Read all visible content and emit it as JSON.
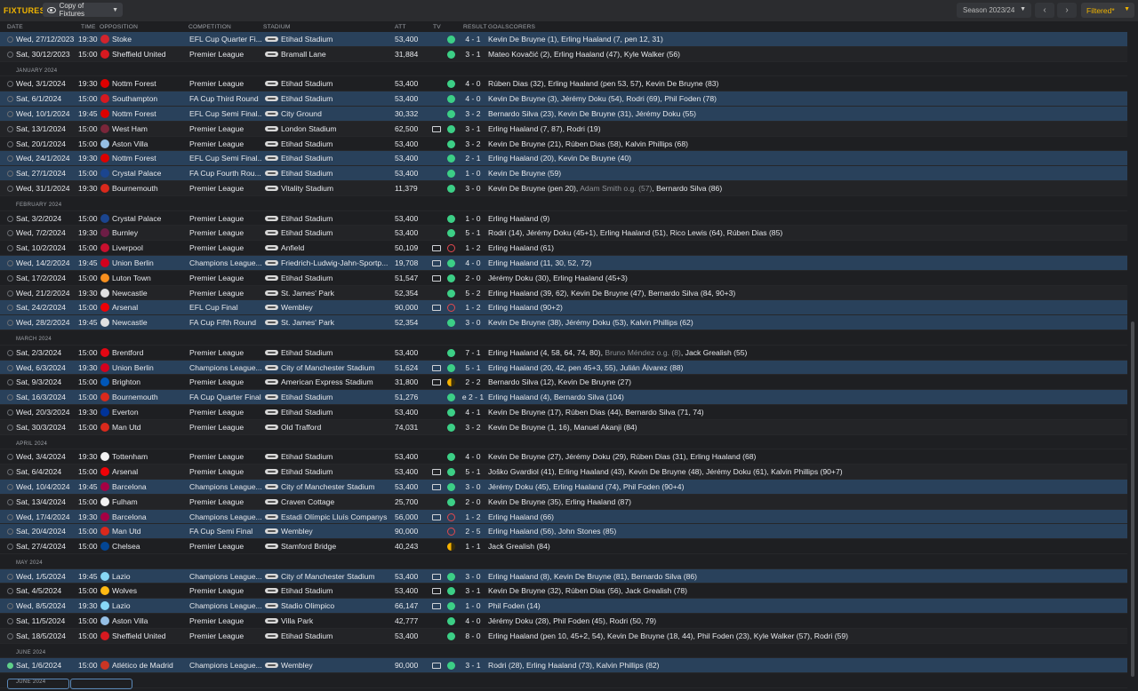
{
  "header": {
    "title": "FIXTURES",
    "view_label": "Copy of Fixtures",
    "season": "Season 2023/24",
    "filter_label": "Filtered*"
  },
  "columns": {
    "date": "DATE",
    "time": "TIME",
    "opposition": "OPPOSITION",
    "competition": "COMPETITION",
    "stadium": "STADIUM",
    "att": "ATT",
    "tv": "TV",
    "result": "RESULT",
    "goalscorers": "GOALSCORERS"
  },
  "colors": {
    "win": "#3ccf86",
    "loss": "#e0484f",
    "draw": "#f5b100",
    "accent": "#f0b400",
    "highlight_row": "#29415b"
  },
  "rows": [
    {
      "date": "Wed, 27/12/2023",
      "time": "19:30",
      "opp": "Stoke",
      "crest": "#d2242d",
      "comp": "EFL Cup Quarter Fi...",
      "stadium": "Etihad Stadium",
      "att": "53,400",
      "tv": false,
      "res": "w",
      "score": "4 - 1",
      "scorers": "Kevin De Bruyne (1), Erling Haaland (7, pen 12, 31)",
      "hl": true
    },
    {
      "date": "Sat, 30/12/2023",
      "time": "15:00",
      "opp": "Sheffield United",
      "crest": "#d71920",
      "comp": "Premier League",
      "stadium": "Bramall Lane",
      "att": "31,884",
      "tv": false,
      "res": "w",
      "score": "3 - 1",
      "scorers": "Mateo Kovačić (2), Erling Haaland (47), Kyle Walker (56)"
    },
    {
      "section": "JANUARY 2024"
    },
    {
      "date": "Wed, 3/1/2024",
      "time": "19:30",
      "opp": "Nottm Forest",
      "crest": "#dd0000",
      "comp": "Premier League",
      "stadium": "Etihad Stadium",
      "att": "53,400",
      "tv": false,
      "res": "w",
      "score": "4 - 0",
      "scorers": "Rúben Dias (32), Erling Haaland (pen 53, 57), Kevin De Bruyne (83)"
    },
    {
      "date": "Sat, 6/1/2024",
      "time": "15:00",
      "opp": "Southampton",
      "crest": "#d71920",
      "comp": "FA Cup Third Round",
      "stadium": "Etihad Stadium",
      "att": "53,400",
      "tv": false,
      "res": "w",
      "score": "4 - 0",
      "scorers": "Kevin De Bruyne (3), Jérémy Doku (54), Rodri (69), Phil Foden (78)",
      "hl": true
    },
    {
      "date": "Wed, 10/1/2024",
      "time": "19:45",
      "opp": "Nottm Forest",
      "crest": "#dd0000",
      "comp": "EFL Cup Semi Final...",
      "stadium": "City Ground",
      "att": "30,332",
      "tv": false,
      "res": "w",
      "score": "3 - 2",
      "scorers": "Bernardo Silva (23), Kevin De Bruyne (31), Jérémy Doku (55)",
      "hl": true
    },
    {
      "date": "Sat, 13/1/2024",
      "time": "15:00",
      "opp": "West Ham",
      "crest": "#7a263a",
      "comp": "Premier League",
      "stadium": "London Stadium",
      "att": "62,500",
      "tv": true,
      "res": "w",
      "score": "3 - 1",
      "scorers": "Erling Haaland (7, 87), Rodri (19)"
    },
    {
      "date": "Sat, 20/1/2024",
      "time": "15:00",
      "opp": "Aston Villa",
      "crest": "#95bfe5",
      "comp": "Premier League",
      "stadium": "Etihad Stadium",
      "att": "53,400",
      "tv": false,
      "res": "w",
      "score": "3 - 2",
      "scorers": "Kevin De Bruyne (21), Rúben Dias (58), Kalvin Phillips (68)"
    },
    {
      "date": "Wed, 24/1/2024",
      "time": "19:30",
      "opp": "Nottm Forest",
      "crest": "#dd0000",
      "comp": "EFL Cup Semi Final...",
      "stadium": "Etihad Stadium",
      "att": "53,400",
      "tv": false,
      "res": "w",
      "score": "2 - 1",
      "scorers": "Erling Haaland (20), Kevin De Bruyne (40)",
      "hl": true
    },
    {
      "date": "Sat, 27/1/2024",
      "time": "15:00",
      "opp": "Crystal Palace",
      "crest": "#1b458f",
      "comp": "FA Cup Fourth Rou...",
      "stadium": "Etihad Stadium",
      "att": "53,400",
      "tv": false,
      "res": "w",
      "score": "1 - 0",
      "scorers": "Kevin De Bruyne (59)",
      "hl": true
    },
    {
      "date": "Wed, 31/1/2024",
      "time": "19:30",
      "opp": "Bournemouth",
      "crest": "#da291c",
      "comp": "Premier League",
      "stadium": "Vitality Stadium",
      "att": "11,379",
      "tv": false,
      "res": "w",
      "score": "3 - 0",
      "scorers": "Kevin De Bruyne (pen 20), {og}Adam Smith o.g. (57){/og}, Bernardo Silva (86)"
    },
    {
      "section": "FEBRUARY 2024"
    },
    {
      "date": "Sat, 3/2/2024",
      "time": "15:00",
      "opp": "Crystal Palace",
      "crest": "#1b458f",
      "comp": "Premier League",
      "stadium": "Etihad Stadium",
      "att": "53,400",
      "tv": false,
      "res": "w",
      "score": "1 - 0",
      "scorers": "Erling Haaland (9)"
    },
    {
      "date": "Wed, 7/2/2024",
      "time": "19:30",
      "opp": "Burnley",
      "crest": "#6c1d45",
      "comp": "Premier League",
      "stadium": "Etihad Stadium",
      "att": "53,400",
      "tv": false,
      "res": "w",
      "score": "5 - 1",
      "scorers": "Rodri (14), Jérémy Doku (45+1), Erling Haaland (51), Rico Lewis (64), Rúben Dias (85)"
    },
    {
      "date": "Sat, 10/2/2024",
      "time": "15:00",
      "opp": "Liverpool",
      "crest": "#c8102e",
      "comp": "Premier League",
      "stadium": "Anfield",
      "att": "50,109",
      "tv": true,
      "res": "l",
      "score": "1 - 2",
      "scorers": "Erling Haaland (61)"
    },
    {
      "date": "Wed, 14/2/2024",
      "time": "19:45",
      "opp": "Union Berlin",
      "crest": "#d4011d",
      "comp": "Champions League...",
      "stadium": "Friedrich-Ludwig-Jahn-Sportp...",
      "att": "19,708",
      "tv": true,
      "res": "w",
      "score": "4 - 0",
      "scorers": "Erling Haaland (11, 30, 52, 72)",
      "hl": true
    },
    {
      "date": "Sat, 17/2/2024",
      "time": "15:00",
      "opp": "Luton Town",
      "crest": "#f78f1e",
      "comp": "Premier League",
      "stadium": "Etihad Stadium",
      "att": "51,547",
      "tv": true,
      "res": "w",
      "score": "2 - 0",
      "scorers": "Jérémy Doku (30), Erling Haaland (45+3)"
    },
    {
      "date": "Wed, 21/2/2024",
      "time": "19:30",
      "opp": "Newcastle",
      "crest": "#e0e0e0",
      "comp": "Premier League",
      "stadium": "St. James' Park",
      "att": "52,354",
      "tv": false,
      "res": "w",
      "score": "5 - 2",
      "scorers": "Erling Haaland (39, 62), Kevin De Bruyne (47), Bernardo Silva (84, 90+3)"
    },
    {
      "date": "Sat, 24/2/2024",
      "time": "15:00",
      "opp": "Arsenal",
      "crest": "#ef0107",
      "comp": "EFL Cup Final",
      "stadium": "Wembley",
      "att": "90,000",
      "tv": true,
      "res": "l",
      "score": "1 - 2",
      "scorers": "Erling Haaland (90+2)",
      "hl": true
    },
    {
      "date": "Wed, 28/2/2024",
      "time": "19:45",
      "opp": "Newcastle",
      "crest": "#e0e0e0",
      "comp": "FA Cup Fifth Round",
      "stadium": "St. James' Park",
      "att": "52,354",
      "tv": false,
      "res": "w",
      "score": "3 - 0",
      "scorers": "Kevin De Bruyne (38), Jérémy Doku (53), Kalvin Phillips (62)",
      "hl": true
    },
    {
      "section": "MARCH 2024"
    },
    {
      "date": "Sat, 2/3/2024",
      "time": "15:00",
      "opp": "Brentford",
      "crest": "#e30613",
      "comp": "Premier League",
      "stadium": "Etihad Stadium",
      "att": "53,400",
      "tv": false,
      "res": "w",
      "score": "7 - 1",
      "scorers": "Erling Haaland (4, 58, 64, 74, 80), {og}Bruno Méndez o.g. (8){/og}, Jack Grealish (55)"
    },
    {
      "date": "Wed, 6/3/2024",
      "time": "19:30",
      "opp": "Union Berlin",
      "crest": "#d4011d",
      "comp": "Champions League...",
      "stadium": "City of Manchester Stadium",
      "att": "51,624",
      "tv": true,
      "res": "w",
      "score": "5 - 1",
      "scorers": "Erling Haaland (20, 42, pen 45+3, 55), Julián Álvarez (88)",
      "hl": true
    },
    {
      "date": "Sat, 9/3/2024",
      "time": "15:00",
      "opp": "Brighton",
      "crest": "#0057b8",
      "comp": "Premier League",
      "stadium": "American Express Stadium",
      "att": "31,800",
      "tv": true,
      "res": "d",
      "score": "2 - 2",
      "scorers": "Bernardo Silva (12), Kevin De Bruyne (27)"
    },
    {
      "date": "Sat, 16/3/2024",
      "time": "15:00",
      "opp": "Bournemouth",
      "crest": "#da291c",
      "comp": "FA Cup Quarter Final",
      "stadium": "Etihad Stadium",
      "att": "51,276",
      "tv": false,
      "res": "w",
      "score": "e 2 - 1",
      "scorers": "Erling Haaland (4), Bernardo Silva (104)",
      "hl": true
    },
    {
      "date": "Wed, 20/3/2024",
      "time": "19:30",
      "opp": "Everton",
      "crest": "#003399",
      "comp": "Premier League",
      "stadium": "Etihad Stadium",
      "att": "53,400",
      "tv": false,
      "res": "w",
      "score": "4 - 1",
      "scorers": "Kevin De Bruyne (17), Rúben Dias (44), Bernardo Silva (71, 74)"
    },
    {
      "date": "Sat, 30/3/2024",
      "time": "15:00",
      "opp": "Man Utd",
      "crest": "#da291c",
      "comp": "Premier League",
      "stadium": "Old Trafford",
      "att": "74,031",
      "tv": false,
      "res": "w",
      "score": "3 - 2",
      "scorers": "Kevin De Bruyne (1, 16), Manuel Akanji (84)"
    },
    {
      "section": "APRIL 2024"
    },
    {
      "date": "Wed, 3/4/2024",
      "time": "19:30",
      "opp": "Tottenham",
      "crest": "#f2f2f2",
      "comp": "Premier League",
      "stadium": "Etihad Stadium",
      "att": "53,400",
      "tv": false,
      "res": "w",
      "score": "4 - 0",
      "scorers": "Kevin De Bruyne (27), Jérémy Doku (29), Rúben Dias (31), Erling Haaland (68)"
    },
    {
      "date": "Sat, 6/4/2024",
      "time": "15:00",
      "opp": "Arsenal",
      "crest": "#ef0107",
      "comp": "Premier League",
      "stadium": "Etihad Stadium",
      "att": "53,400",
      "tv": true,
      "res": "w",
      "score": "5 - 1",
      "scorers": "Joško Gvardiol (41), Erling Haaland (43), Kevin De Bruyne (48), Jérémy Doku (61), Kalvin Phillips (90+7)"
    },
    {
      "date": "Wed, 10/4/2024",
      "time": "19:45",
      "opp": "Barcelona",
      "crest": "#a50044",
      "comp": "Champions League...",
      "stadium": "City of Manchester Stadium",
      "att": "53,400",
      "tv": true,
      "res": "w",
      "score": "3 - 0",
      "scorers": "Jérémy Doku (45), Erling Haaland (74), Phil Foden (90+4)",
      "hl": true
    },
    {
      "date": "Sat, 13/4/2024",
      "time": "15:00",
      "opp": "Fulham",
      "crest": "#f2f2f2",
      "comp": "Premier League",
      "stadium": "Craven Cottage",
      "att": "25,700",
      "tv": false,
      "res": "w",
      "score": "2 - 0",
      "scorers": "Kevin De Bruyne (35), Erling Haaland (87)"
    },
    {
      "date": "Wed, 17/4/2024",
      "time": "19:30",
      "opp": "Barcelona",
      "crest": "#a50044",
      "comp": "Champions League...",
      "stadium": "Estadi Olímpic Lluís Companys",
      "att": "56,000",
      "tv": true,
      "res": "l",
      "score": "1 - 2",
      "scorers": "Erling Haaland (66)",
      "hl": true
    },
    {
      "date": "Sat, 20/4/2024",
      "time": "15:00",
      "opp": "Man Utd",
      "crest": "#da291c",
      "comp": "FA Cup Semi Final",
      "stadium": "Wembley",
      "att": "90,000",
      "tv": false,
      "res": "l",
      "score": "2 - 5",
      "scorers": "Erling Haaland (56), John Stones (85)",
      "hl": true
    },
    {
      "date": "Sat, 27/4/2024",
      "time": "15:00",
      "opp": "Chelsea",
      "crest": "#034694",
      "comp": "Premier League",
      "stadium": "Stamford Bridge",
      "att": "40,243",
      "tv": false,
      "res": "d",
      "score": "1 - 1",
      "scorers": "Jack Grealish (84)"
    },
    {
      "section": "MAY 2024"
    },
    {
      "date": "Wed, 1/5/2024",
      "time": "19:45",
      "opp": "Lazio",
      "crest": "#87d8f7",
      "comp": "Champions League...",
      "stadium": "City of Manchester Stadium",
      "att": "53,400",
      "tv": true,
      "res": "w",
      "score": "3 - 0",
      "scorers": "Erling Haaland (8), Kevin De Bruyne (81), Bernardo Silva (86)",
      "hl": true
    },
    {
      "date": "Sat, 4/5/2024",
      "time": "15:00",
      "opp": "Wolves",
      "crest": "#fdb913",
      "comp": "Premier League",
      "stadium": "Etihad Stadium",
      "att": "53,400",
      "tv": true,
      "res": "w",
      "score": "3 - 1",
      "scorers": "Kevin De Bruyne (32), Rúben Dias (56), Jack Grealish (78)"
    },
    {
      "date": "Wed, 8/5/2024",
      "time": "19:30",
      "opp": "Lazio",
      "crest": "#87d8f7",
      "comp": "Champions League...",
      "stadium": "Stadio Olimpico",
      "att": "66,147",
      "tv": true,
      "res": "w",
      "score": "1 - 0",
      "scorers": "Phil Foden (14)",
      "hl": true
    },
    {
      "date": "Sat, 11/5/2024",
      "time": "15:00",
      "opp": "Aston Villa",
      "crest": "#95bfe5",
      "comp": "Premier League",
      "stadium": "Villa Park",
      "att": "42,777",
      "tv": false,
      "res": "w",
      "score": "4 - 0",
      "scorers": "Jérémy Doku (28), Phil Foden (45), Rodri (50, 79)"
    },
    {
      "date": "Sat, 18/5/2024",
      "time": "15:00",
      "opp": "Sheffield United",
      "crest": "#d71920",
      "comp": "Premier League",
      "stadium": "Etihad Stadium",
      "att": "53,400",
      "tv": false,
      "res": "w",
      "score": "8 - 0",
      "scorers": "Erling Haaland (pen 10, 45+2, 54), Kevin De Bruyne (18, 44), Phil Foden (23), Kyle Walker (57), Rodri (59)"
    },
    {
      "section": "JUNE 2024"
    },
    {
      "date": "Sat, 1/6/2024",
      "time": "15:00",
      "opp": "Atlético de Madrid",
      "crest": "#cb3524",
      "comp": "Champions League...",
      "stadium": "Wembley",
      "att": "90,000",
      "tv": true,
      "res": "w",
      "score": "3 - 1",
      "scorers": "Rodri (28), Erling Haaland (73), Kalvin Phillips (82)",
      "hl": true,
      "checked": true
    },
    {
      "section": "JUNE 2024"
    }
  ]
}
